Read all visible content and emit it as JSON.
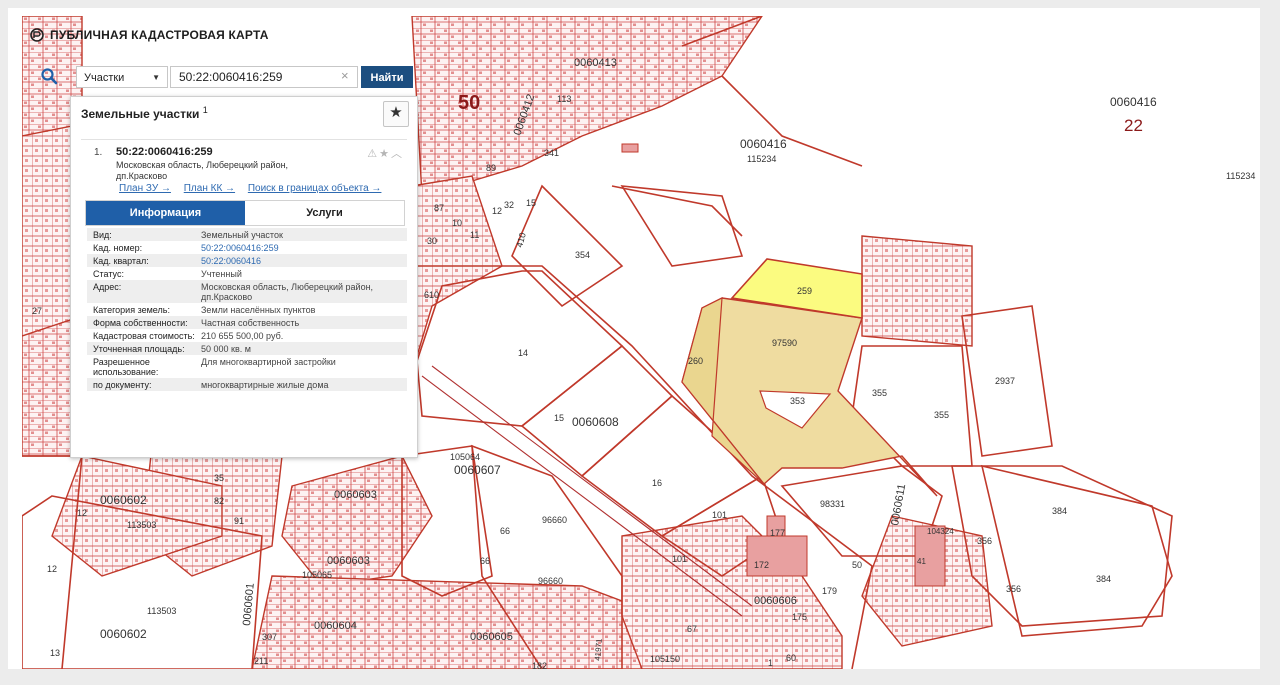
{
  "app": {
    "title": "ПУБЛИЧНАЯ КАДАСТРОВАЯ КАРТА"
  },
  "search": {
    "type_label": "Участки",
    "query": "50:22:0060416:259",
    "find_label": "Найти"
  },
  "panel": {
    "title": "Земельные участки",
    "count": "1",
    "result": {
      "index": "1.",
      "cad_number": "50:22:0060416:259",
      "address_line1": "Московская область, Люберецкий район,",
      "address_line2": "дп.Красково",
      "links": [
        "План ЗУ →",
        "План КК →",
        "Поиск в границах объекта →"
      ]
    },
    "tabs": [
      {
        "label": "Информация",
        "active": true
      },
      {
        "label": "Услуги",
        "active": false
      }
    ],
    "properties": [
      {
        "key": "Вид:",
        "value": "Земельный участок"
      },
      {
        "key": "Кад. номер:",
        "value": "50:22:0060416:259",
        "link": true
      },
      {
        "key": "Кад. квартал:",
        "value": "50:22:0060416",
        "link": true
      },
      {
        "key": "Статус:",
        "value": "Учтенный"
      },
      {
        "key": "Адрес:",
        "value": "Московская область, Люберецкий район, дп.Красково"
      },
      {
        "key": "Категория земель:",
        "value": "Земли населённых пунктов"
      },
      {
        "key": "Форма собственности:",
        "value": "Частная собственность"
      },
      {
        "key": "Кадастровая стоимость:",
        "value": "210 655 500,00 руб."
      },
      {
        "key": "Уточненная площадь:",
        "value": "50 000 кв. м"
      },
      {
        "key": "Разрешенное использование:",
        "value": "Для многоквартирной застройки"
      },
      {
        "key": "по документу:",
        "value": "многоквартирные жилые дома"
      }
    ]
  },
  "map": {
    "colors": {
      "boundary": "#c0392b",
      "highlight": "#fbfb80",
      "parcel_fill": "#f0dfa0",
      "building": "#e8a0a0"
    },
    "big_labels": [
      "50",
      "22"
    ],
    "labels": [
      "0060416",
      "0060416",
      "115234",
      "115234",
      "0060413",
      "0060412",
      "113",
      "341",
      "89",
      "87",
      "10",
      "11",
      "12",
      "32",
      "15",
      "410",
      "30",
      "354",
      "14",
      "15",
      "0060608",
      "16",
      "259",
      "97590",
      "260",
      "353",
      "355",
      "355",
      "2937",
      "105064",
      "0060607",
      "96660",
      "96660",
      "66",
      "66",
      "101",
      "101",
      "177",
      "172",
      "179",
      "175",
      "50",
      "98331",
      "0060611",
      "104324",
      "41",
      "384",
      "384",
      "356",
      "356",
      "0060602",
      "113503",
      "113503",
      "12",
      "12",
      "13",
      "35",
      "82",
      "91",
      "0060603",
      "105065",
      "0060603",
      "0060601",
      "307",
      "211",
      "0060604",
      "0060605",
      "105150",
      "67",
      "0060606",
      "182",
      "41971",
      "1",
      "60",
      "27",
      "610",
      "0060602"
    ]
  }
}
